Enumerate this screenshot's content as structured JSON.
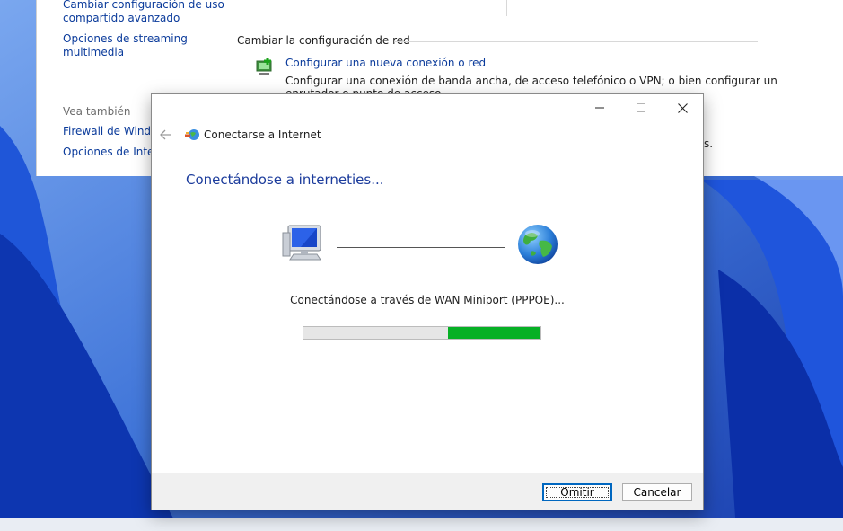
{
  "background_window": {
    "left_links": [
      "Cambiar configuración de uso",
      "compartido avanzado",
      "Opciones de streaming",
      "multimedia"
    ],
    "see_also_heading": "Vea también",
    "see_also_links": [
      "Firewall de Window",
      "Opciones de Intern"
    ],
    "section_heading": "Cambiar la configuración de red",
    "new_connection_link": "Configurar una nueva conexión o red",
    "new_connection_desc": "Configurar una conexión de banda ancha, de acceso telefónico o VPN; o bien configurar un",
    "new_connection_desc2": "enrutador o punto de acceso.",
    "right_partial_text": "s."
  },
  "dialog": {
    "window_title": "Conectarse a Internet",
    "heading": "Conectándose a interneties...",
    "status": "Conectándose a través de WAN Miniport (PPPOE)...",
    "progress": {
      "start_fraction": 0.61,
      "end_fraction": 1.0,
      "color": "#06b025"
    },
    "buttons": {
      "skip": "Omitir",
      "cancel": "Cancelar"
    }
  },
  "icons": {
    "back": "back-arrow-icon",
    "app": "network-globe-icon",
    "computer": "computer-icon",
    "internet": "globe-icon",
    "new_connection": "network-setup-icon"
  },
  "colors": {
    "link": "#0b3b9b",
    "heading": "#1c3c9c",
    "progress": "#06b025",
    "accent_focus": "#0067c0"
  }
}
